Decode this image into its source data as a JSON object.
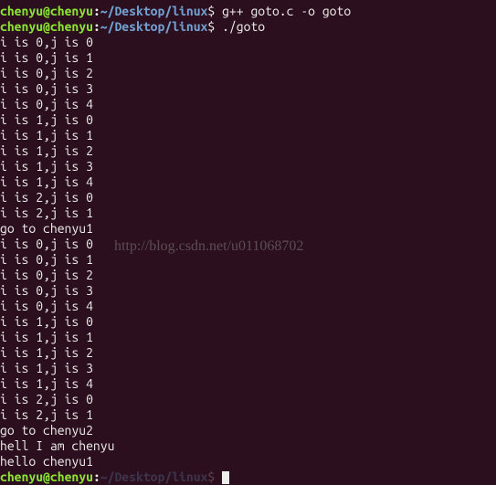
{
  "user": "chenyu",
  "host": "chenyu",
  "path": "~/Desktop/linux",
  "partial_path": "~/Desktop/linux",
  "commands": {
    "compile": "g++ goto.c -o goto",
    "run": "./goto"
  },
  "output": [
    "i is 0,j is 0",
    "i is 0,j is 1",
    "i is 0,j is 2",
    "i is 0,j is 3",
    "i is 0,j is 4",
    "i is 1,j is 0",
    "i is 1,j is 1",
    "i is 1,j is 2",
    "i is 1,j is 3",
    "i is 1,j is 4",
    "i is 2,j is 0",
    "i is 2,j is 1",
    "go to chenyu1",
    "i is 0,j is 0",
    "i is 0,j is 1",
    "i is 0,j is 2",
    "i is 0,j is 3",
    "i is 0,j is 4",
    "i is 1,j is 0",
    "i is 1,j is 1",
    "i is 1,j is 2",
    "i is 1,j is 3",
    "i is 1,j is 4",
    "i is 2,j is 0",
    "i is 2,j is 1",
    "go to chenyu2",
    "hell I am chenyu",
    "hello chenyu1"
  ],
  "watermark": "http://blog.csdn.net/u011068702"
}
